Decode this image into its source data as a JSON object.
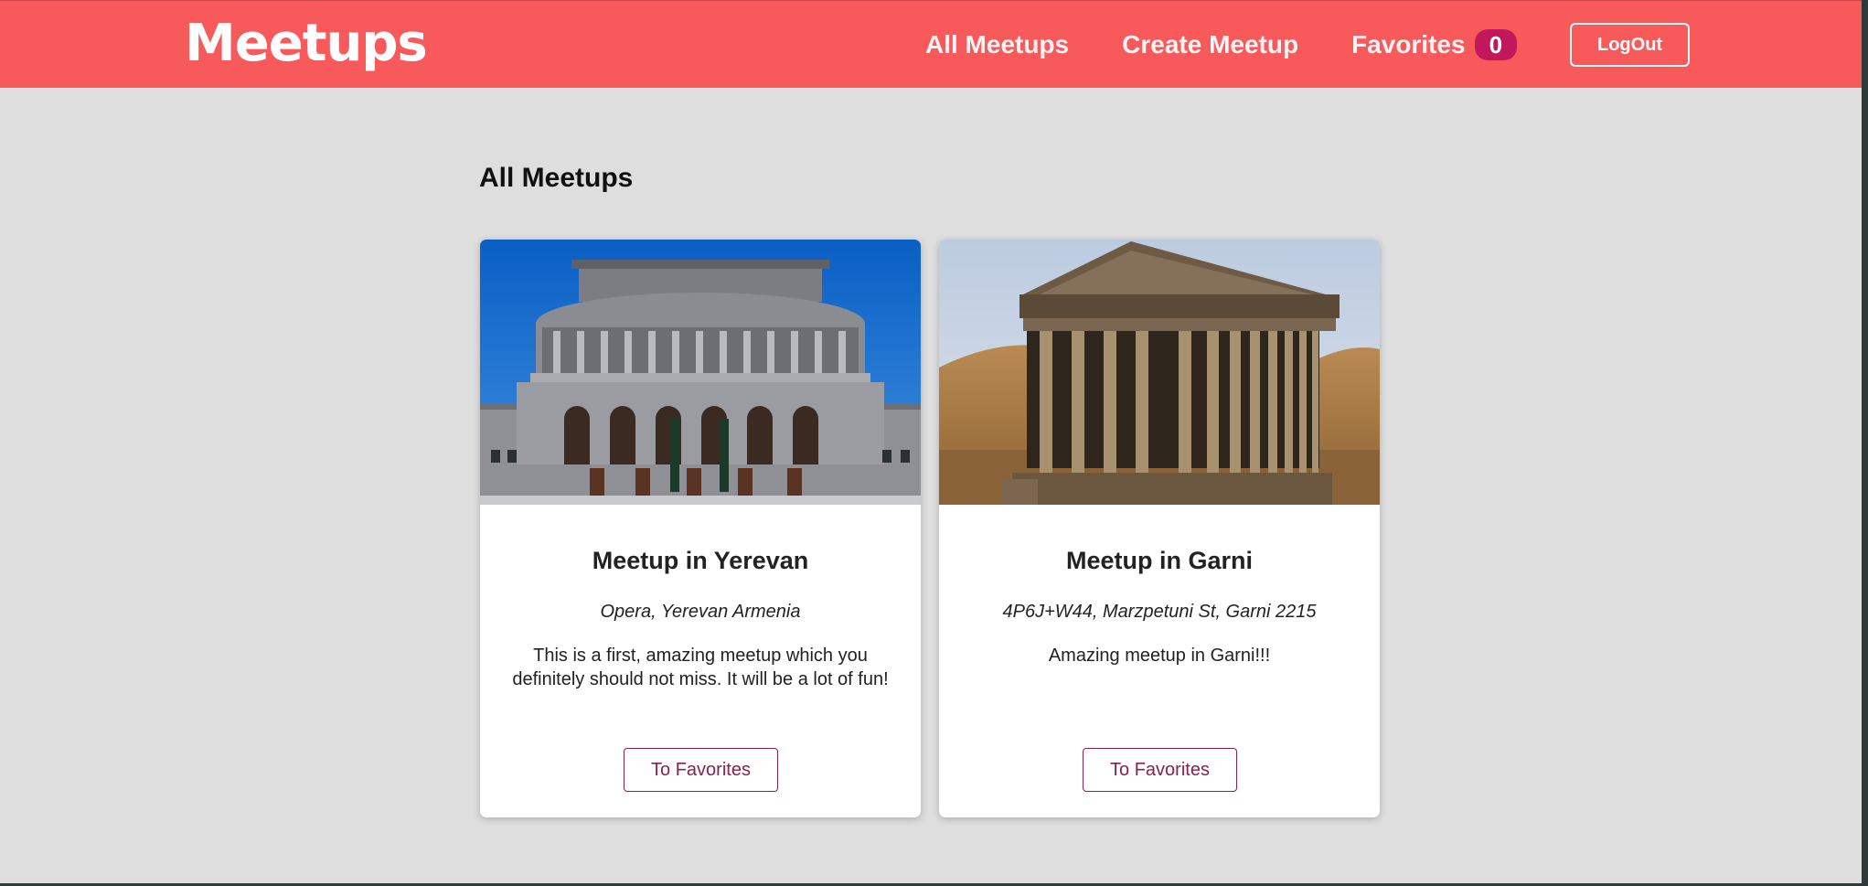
{
  "header": {
    "logo": "Meetups",
    "nav": {
      "all_meetups": "All Meetups",
      "create_meetup": "Create Meetup",
      "favorites": "Favorites",
      "favorites_count": "0"
    },
    "logout_label": "LogOut"
  },
  "main": {
    "title": "All Meetups",
    "meetups": [
      {
        "title": "Meetup in Yerevan",
        "address": "Opera, Yerevan Armenia",
        "description": "This is a first, amazing meetup which you definitely should not miss. It will be a lot of fun!",
        "button_label": "To Favorites"
      },
      {
        "title": "Meetup in Garni",
        "address": "4P6J+W44, Marzpetuni St, Garni 2215",
        "description": "Amazing meetup in Garni!!!",
        "button_label": "To Favorites"
      }
    ]
  },
  "colors": {
    "header_bg": "#f85a5c",
    "badge_bg": "#c2185b",
    "button_accent": "#8b1f4e",
    "page_bg": "#dedede"
  }
}
